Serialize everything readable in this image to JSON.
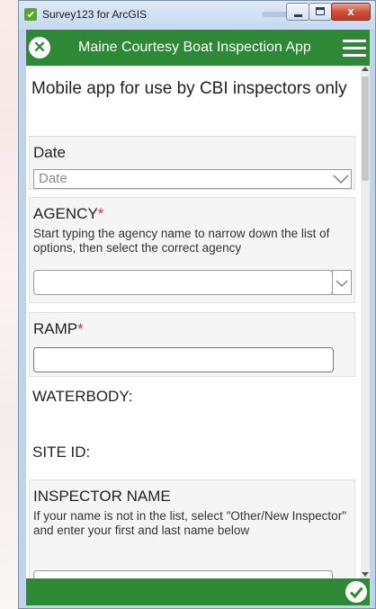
{
  "window": {
    "title": "Survey123 for ArcGIS",
    "close_glyph": "x"
  },
  "header": {
    "title": "Maine Courtesy Boat Inspection App",
    "close_icon": "close-icon",
    "menu_icon": "hamburger-menu-icon",
    "accent_color": "#2d8936"
  },
  "form": {
    "intro": "Mobile app for use by CBI inspectors only",
    "date": {
      "label": "Date",
      "placeholder": "Date"
    },
    "agency": {
      "label": "AGENCY",
      "required_mark": "*",
      "hint": "Start typing the agency name to narrow down the list of options, then select the correct agency",
      "value": ""
    },
    "ramp": {
      "label": "RAMP",
      "required_mark": "*",
      "value": ""
    },
    "waterbody": {
      "label": "WATERBODY:"
    },
    "site_id": {
      "label": "SITE ID:"
    },
    "inspector_name": {
      "label": "INSPECTOR NAME",
      "hint": "If your name is not in the list, select \"Other/New Inspector\" and enter your first and last name below"
    }
  },
  "footer": {
    "submit_icon": "checkmark-icon"
  },
  "colors": {
    "required": "#d62f2f",
    "close_button": "#c13a25"
  }
}
